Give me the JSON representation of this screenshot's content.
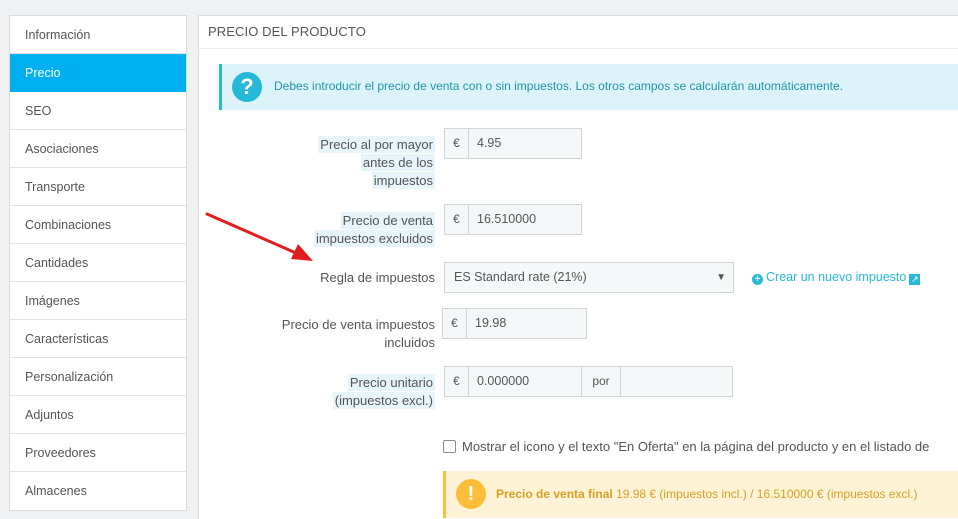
{
  "sidebar": {
    "items": [
      {
        "label": "Información"
      },
      {
        "label": "Precio"
      },
      {
        "label": "SEO"
      },
      {
        "label": "Asociaciones"
      },
      {
        "label": "Transporte"
      },
      {
        "label": "Combinaciones"
      },
      {
        "label": "Cantidades"
      },
      {
        "label": "Imágenes"
      },
      {
        "label": "Características"
      },
      {
        "label": "Personalización"
      },
      {
        "label": "Adjuntos"
      },
      {
        "label": "Proveedores"
      },
      {
        "label": "Almacenes"
      }
    ],
    "active_index": 1
  },
  "panel": {
    "title": "PRECIO DEL PRODUCTO",
    "info_message": "Debes introducir el precio de venta con o sin impuestos. Los otros campos se calcularán automáticamente.",
    "wholesale": {
      "label_l1": "Precio al por mayor",
      "label_l2": "antes de los",
      "label_l3": "impuestos",
      "currency": "€",
      "value": "4.95"
    },
    "price_excl": {
      "label_l1": "Precio de venta",
      "label_l2": "impuestos excluidos",
      "currency": "€",
      "value": "16.510000"
    },
    "tax_rule": {
      "label": "Regla de impuestos",
      "selected": "ES Standard rate (21%)",
      "new_link": "Crear un nuevo impuesto"
    },
    "price_incl": {
      "label_l1": "Precio de venta impuestos",
      "label_l2": "incluidos",
      "currency": "€",
      "value": "19.98"
    },
    "unit_price": {
      "label_l1": "Precio unitario",
      "label_l2": "(impuestos excl.)",
      "currency": "€",
      "value": "0.000000",
      "per": "por",
      "unit": ""
    },
    "on_sale_label": "Mostrar el icono y el texto \"En Oferta\" en la página del producto y en el listado de",
    "final_price": {
      "label": "Precio de venta final",
      "text": "19.98 € (impuestos incl.) / 16.510000 € (impuestos excl.)"
    }
  },
  "colors": {
    "accent": "#00aff0",
    "info": "#25b9d7",
    "warning": "#fcbe39",
    "annotation_arrow": "#e01e1e"
  }
}
